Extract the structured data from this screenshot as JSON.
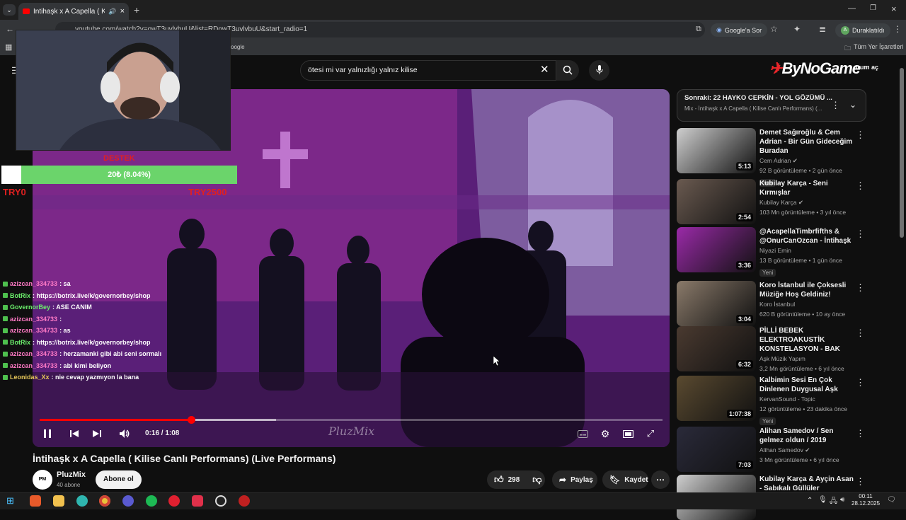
{
  "browser": {
    "tab_title": "İntihaşk x A Capella ( Kilise",
    "url": "youtube.com/watch?v=owT3uvlvbuU&list=RDowT3uvlvbuU&start_radio=1",
    "google_sor_label": "Google'a Sor",
    "profile_label": "Duraklatıldı",
    "bookmarks_partial": "oogle",
    "all_bookmarks": "Tüm Yer İşaretleri"
  },
  "overlay": {
    "donation_goal_label": "DESTEK",
    "donation_amount": "20₺ (8.04%)",
    "donation_fraction": 0.0804,
    "min_label": "TRY0",
    "max_label": "TRY2500",
    "watermark": "PluzMix",
    "logo_text": "ByNoGame"
  },
  "chat": [
    {
      "user": "azizcan_334733",
      "message": ": sa",
      "user_color": "#ff7ac6"
    },
    {
      "user": "BotRix",
      "message": ": https://botrix.live/k/governorbey/shop",
      "user_color": "#6cf06c"
    },
    {
      "user": "GovernorBey",
      "message": ": ASE CANIM",
      "user_color": "#6cf06c"
    },
    {
      "user": "azizcan_334733",
      "message": ":",
      "user_color": "#ff7ac6"
    },
    {
      "user": "azizcan_334733",
      "message": ": as",
      "user_color": "#ff7ac6"
    },
    {
      "user": "BotRix",
      "message": ": https://botrix.live/k/governorbey/shop",
      "user_color": "#6cf06c"
    },
    {
      "user": "azizcan_334733",
      "message": ": herzamanki gibi abi seni sormalı",
      "user_color": "#ff7ac6"
    },
    {
      "user": "azizcan_334733",
      "message": ": abi kimi beliyon",
      "user_color": "#ff7ac6"
    },
    {
      "user": "Leonidas_Xx",
      "message": ": nie cevap yazmıyon la bana",
      "user_color": "#e8c85a"
    }
  ],
  "search": {
    "query": "ötesi mi var yalnızlığı yalnız kilise",
    "signin_partial": "urum aç"
  },
  "player": {
    "time": "0:16 / 1:08",
    "progress_fraction": 0.243,
    "buffer_fraction": 0.38
  },
  "video": {
    "title": "İntihaşk x A Capella ( Kilise Canlı Performans) (Live Performans)",
    "channel": "PluzMix",
    "subscribers": "40 abone",
    "subscribe_label": "Abone ol",
    "likes": "298",
    "share_label": "Paylaş",
    "save_label": "Kaydet"
  },
  "up_next": {
    "title": "Sonraki: 22 HAYKO CEPKİN - YOL GÖZÜMÜ ...",
    "subtitle": "Mix - İntihaşk x A Capella ( Kilise Canlı Performans) (..."
  },
  "recommendations": [
    {
      "title": "Demet Sağıroğlu & Cem Adrian - Bir Gün Gideceğim Buradan",
      "channel": "Cem Adrian",
      "verified": true,
      "meta": "92 B görüntüleme • 2 gün önce",
      "badge": "Yeni",
      "duration": "5:13",
      "thumb_color": "#cfcfcf"
    },
    {
      "title": "Kubilay Karça - Seni Kırmışlar",
      "channel": "Kubilay Karça",
      "verified": true,
      "meta": "103 Mn görüntüleme • 3 yıl önce",
      "badge": "",
      "duration": "2:54",
      "thumb_color": "#6a5a50"
    },
    {
      "title": "@AcapellaTimbrfifths & @OnurCanOzcan - İntihaşk",
      "channel": "Niyazi Emin",
      "verified": false,
      "meta": "13 B görüntüleme • 1 gün önce",
      "badge": "Yeni",
      "duration": "3:36",
      "thumb_color": "#9a2aa8"
    },
    {
      "title": "Koro İstanbul ile  Çoksesli Müziğe Hoş Geldiniz!",
      "channel": "Koro İstanbul",
      "verified": false,
      "meta": "620 B görüntüleme • 10 ay önce",
      "badge": "",
      "duration": "3:04",
      "thumb_color": "#8a7a6a"
    },
    {
      "title": "PİLLİ BEBEK ELEKTROAKUSTİK KONSTELASYON - BAK",
      "channel": "Aşk Müzik Yapım",
      "verified": false,
      "meta": "3,2 Mn görüntüleme • 6 yıl önce",
      "badge": "",
      "duration": "6:32",
      "thumb_color": "#4a3a30"
    },
    {
      "title": "Kalbimin Sesi En Çok Dinlenen Duygusal Aşk",
      "channel": "KervanSound - Topic",
      "verified": false,
      "meta": "12 görüntüleme • 23 dakika önce",
      "badge": "Yeni",
      "duration": "1:07:38",
      "thumb_color": "#5a4a30"
    },
    {
      "title": "Alihan Samedov / Sen gelmez oldun / 2019",
      "channel": "Alihan Samedov",
      "verified": true,
      "meta": "3 Mn görüntüleme • 6 yıl önce",
      "badge": "",
      "duration": "7:03",
      "thumb_color": "#2a2a3a"
    },
    {
      "title": "Kubilay Karça & Ayçin Asan - Sabıkalı Güllüler",
      "channel": "",
      "verified": false,
      "meta": "",
      "badge": "",
      "duration": "",
      "thumb_color": "#cfcfcf"
    }
  ],
  "taskbar": {
    "time": "00:11",
    "date": "28.12.2025"
  }
}
